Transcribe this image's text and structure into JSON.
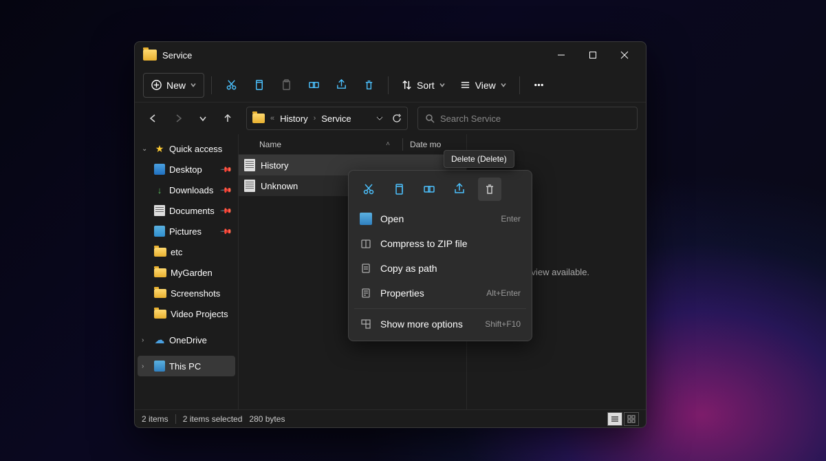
{
  "titlebar": {
    "title": "Service"
  },
  "toolbar": {
    "new_label": "New",
    "sort_label": "Sort",
    "view_label": "View"
  },
  "breadcrumb": {
    "seg1": "History",
    "seg2": "Service"
  },
  "search": {
    "placeholder": "Search Service"
  },
  "columns": {
    "name": "Name",
    "date": "Date mo"
  },
  "files": [
    {
      "name": "History"
    },
    {
      "name": "Unknown"
    }
  ],
  "sidebar": {
    "quick": "Quick access",
    "desktop": "Desktop",
    "downloads": "Downloads",
    "documents": "Documents",
    "pictures": "Pictures",
    "etc": "etc",
    "mygarden": "MyGarden",
    "screenshots": "Screenshots",
    "videoprojects": "Video Projects",
    "onedrive": "OneDrive",
    "thispc": "This PC"
  },
  "preview": {
    "empty": "review available."
  },
  "status": {
    "items": "2 items",
    "selected": "2 items selected",
    "size": "280 bytes"
  },
  "context_menu": {
    "open": "Open",
    "open_short": "Enter",
    "zip": "Compress to ZIP file",
    "copypath": "Copy as path",
    "properties": "Properties",
    "properties_short": "Alt+Enter",
    "more": "Show more options",
    "more_short": "Shift+F10"
  },
  "tooltip": {
    "delete": "Delete (Delete)"
  }
}
